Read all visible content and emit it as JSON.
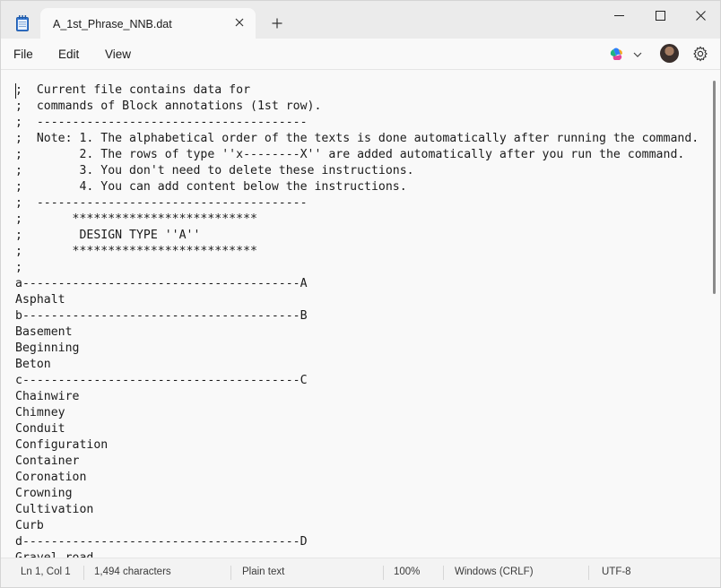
{
  "tab": {
    "title": "A_1st_Phrase_NNB.dat"
  },
  "menu": {
    "file": "File",
    "edit": "Edit",
    "view": "View"
  },
  "editor": {
    "lines": [
      ";  Current file contains data for",
      ";  commands of Block annotations (1st row).",
      ";  --------------------------------------",
      ";  Note: 1. The alphabetical order of the texts is done automatically after running the command.",
      ";        2. The rows of type ''x--------X'' are added automatically after you run the command.",
      ";        3. You don't need to delete these instructions.",
      ";        4. You can add content below the instructions.",
      ";  --------------------------------------",
      ";       **************************",
      ";        DESIGN TYPE ''A''",
      ";       **************************",
      ";",
      "a---------------------------------------A",
      "Asphalt",
      "b---------------------------------------B",
      "Basement",
      "Beginning",
      "Beton",
      "c---------------------------------------C",
      "Chainwire",
      "Chimney",
      "Conduit",
      "Configuration",
      "Container",
      "Coronation",
      "Crowning",
      "Cultivation",
      "Curb",
      "d---------------------------------------D",
      "Gravel road"
    ]
  },
  "status": {
    "position": "Ln 1, Col 1",
    "characters": "1,494 characters",
    "format": "Plain text",
    "zoom": "100%",
    "line_endings": "Windows (CRLF)",
    "encoding": "UTF-8"
  },
  "icons": {
    "app": "notepad-icon",
    "copilot": "copilot-icon",
    "settings": "gear-icon"
  }
}
